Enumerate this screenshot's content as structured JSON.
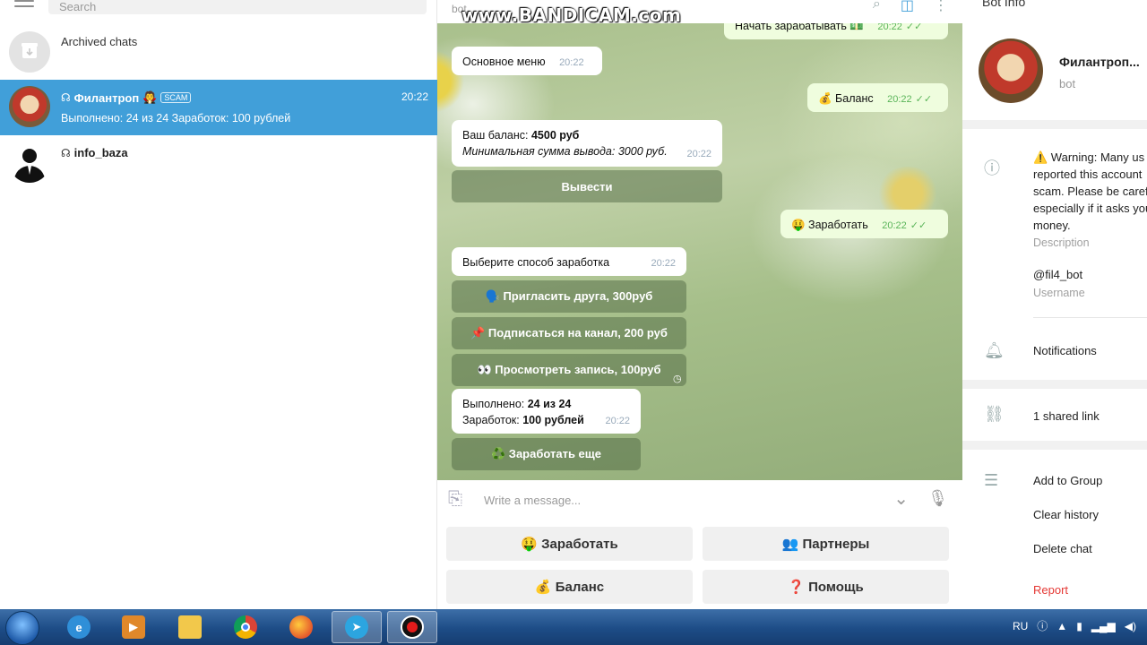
{
  "window": {
    "bot_name_header": "bot",
    "watermark": "www.BANDICAM.com"
  },
  "left": {
    "search_placeholder": "Search",
    "chats": [
      {
        "title": "Archived chats",
        "subtitle": "",
        "time": ""
      },
      {
        "title": "Филантроп",
        "emoji": "🧛",
        "badge": "SCAM",
        "subtitle": "Выполнено: 24 из 24 Заработок: 100 рублей",
        "time": "20:22"
      },
      {
        "title": "info_baza",
        "subtitle": "",
        "time": ""
      }
    ]
  },
  "messages": [
    {
      "text": "Начать зарабатывать 💵",
      "time": "20:22",
      "out": true
    },
    {
      "text": "Основное меню",
      "time": "20:22",
      "out": false
    },
    {
      "text": "💰 Баланс",
      "time": "20:22",
      "out": true
    },
    {
      "line1_prefix": "Ваш баланс: ",
      "line1_value": "4500 руб",
      "line2": "Минимальная сумма вывода: 3000 руб.",
      "time": "20:22",
      "out": false
    },
    {
      "button": "Вывести"
    },
    {
      "text": "🤑 Заработать",
      "time": "20:22",
      "out": true
    },
    {
      "text": "Выберите способ заработка",
      "time": "20:22",
      "out": false
    },
    {
      "buttons": [
        "🗣️ Пригласить друга, 300руб",
        "📌 Подписаться на канал, 200 руб",
        "👀 Просмотреть запись, 100руб"
      ]
    },
    {
      "line1_prefix": "Выполнено: ",
      "line1_value": "24 из 24",
      "line2_prefix": "Заработок: ",
      "line2_value": "100 рублей",
      "time": "20:22",
      "out": false
    },
    {
      "button": "♻️ Заработать еще"
    }
  ],
  "composer": {
    "placeholder": "Write a message..."
  },
  "reply_keyboard": [
    "🤑 Заработать",
    "👥 Партнеры",
    "💰 Баланс",
    "❓ Помощь"
  ],
  "right": {
    "title": "Bot Info",
    "name": "Филантроп...",
    "sub": "bot",
    "warning_lines": [
      "⚠️ Warning: Many us",
      "reported this account",
      "scam. Please be caref",
      "especially if it asks you",
      "money."
    ],
    "description_label": "Description",
    "username": "@fil4_bot",
    "username_label": "Username",
    "notifications": "Notifications",
    "shared_links": "1 shared link",
    "actions": [
      "Add to Group",
      "Clear history",
      "Delete chat",
      "Report"
    ],
    "report_color": "#e53935"
  },
  "taskbar": {
    "lang": "RU",
    "apps": [
      "ie",
      "media",
      "folder",
      "chrome",
      "firefox",
      "telegram",
      "recorder"
    ]
  },
  "colors": {
    "selected_chat": "#419fd9",
    "out_bubble": "#effdde",
    "check": "#5bb55a"
  }
}
